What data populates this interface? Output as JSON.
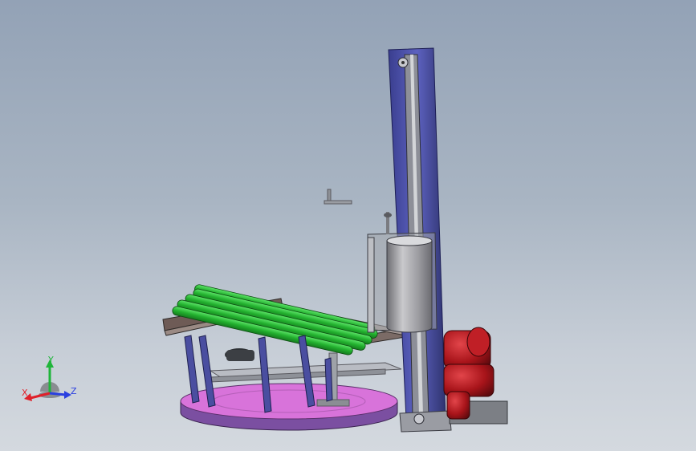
{
  "triad": {
    "x_label": "X",
    "y_label": "Y",
    "z_label": "Z",
    "x_color": "#e0202a",
    "y_color": "#1fb53a",
    "z_color": "#2a3fe0"
  },
  "colors": {
    "background_top": "#93a2b6",
    "background_bottom": "#d4d9df",
    "turntable_top": "#d46ad8",
    "turntable_rim": "#7a4ea0",
    "mast": "#4b4fa8",
    "rollers": "#2ec23a",
    "motor": "#b0181e",
    "film_roll": "#a8a8ad"
  }
}
